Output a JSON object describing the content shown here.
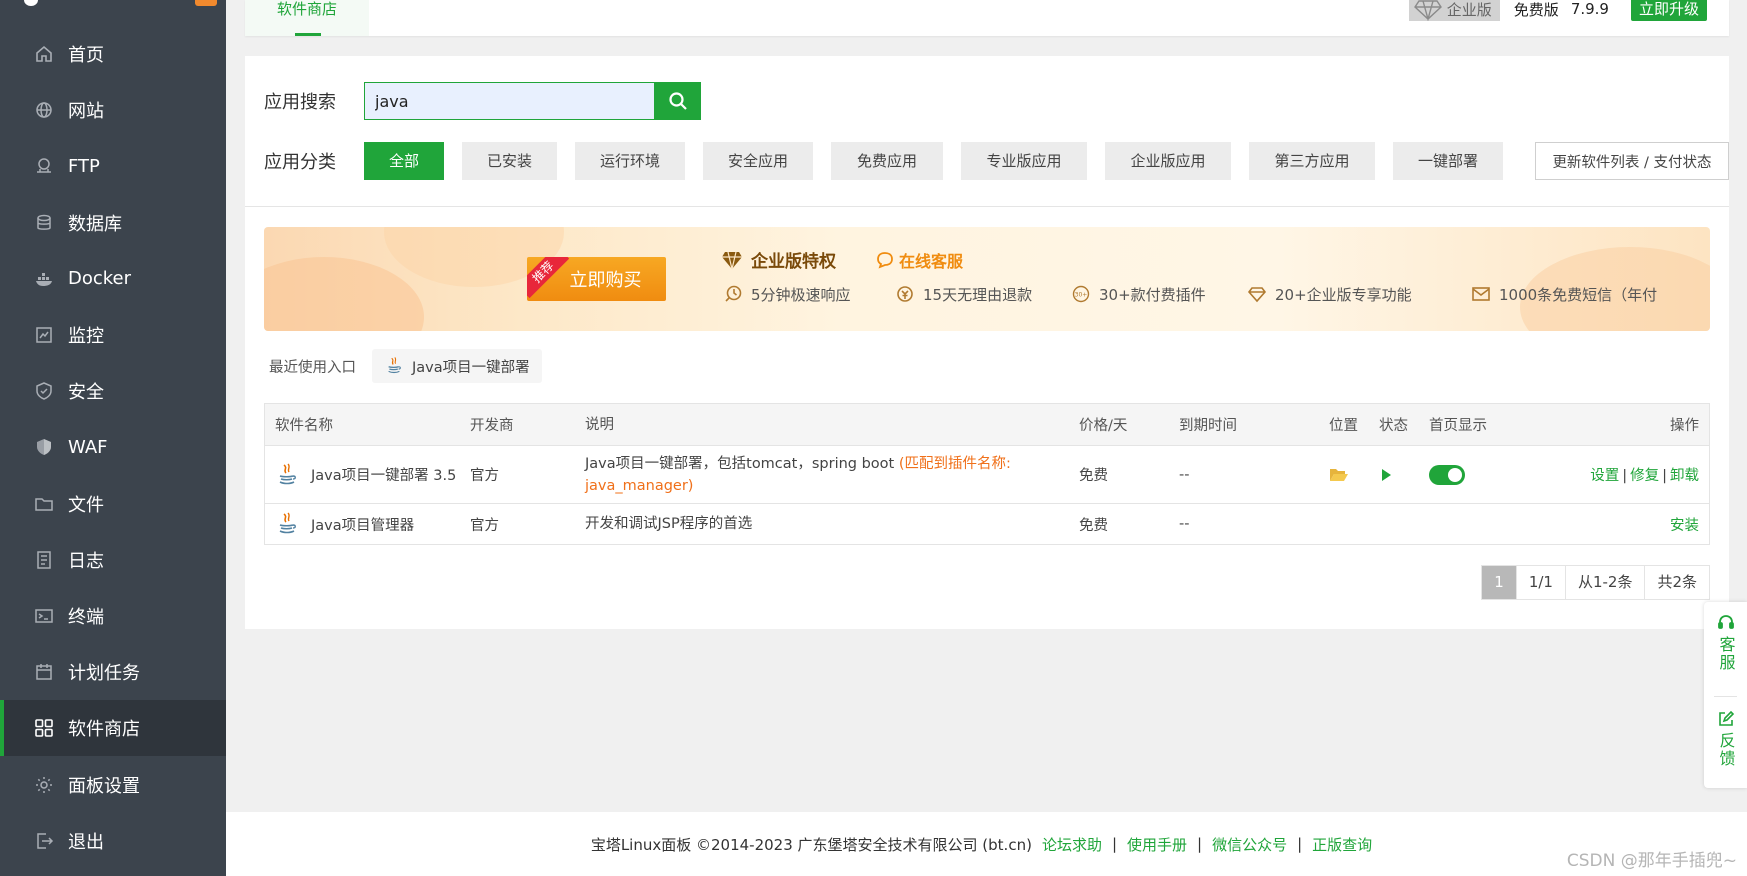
{
  "sidebar": {
    "items": [
      {
        "label": "首页",
        "icon": "home-icon"
      },
      {
        "label": "网站",
        "icon": "globe-icon"
      },
      {
        "label": "FTP",
        "icon": "ftp-icon"
      },
      {
        "label": "数据库",
        "icon": "database-icon"
      },
      {
        "label": "Docker",
        "icon": "docker-icon"
      },
      {
        "label": "监控",
        "icon": "monitor-icon"
      },
      {
        "label": "安全",
        "icon": "shield-icon"
      },
      {
        "label": "WAF",
        "icon": "waf-icon"
      },
      {
        "label": "文件",
        "icon": "folder-icon"
      },
      {
        "label": "日志",
        "icon": "log-icon"
      },
      {
        "label": "终端",
        "icon": "terminal-icon"
      },
      {
        "label": "计划任务",
        "icon": "calendar-icon"
      },
      {
        "label": "软件商店",
        "icon": "apps-icon",
        "active": true
      },
      {
        "label": "面板设置",
        "icon": "gear-icon"
      },
      {
        "label": "退出",
        "icon": "logout-icon"
      }
    ]
  },
  "header": {
    "tab_label": "软件商店",
    "edition_badge": "企业版",
    "free_label": "免费版",
    "version": "7.9.9",
    "upgrade_label": "立即升级"
  },
  "search": {
    "label": "应用搜索",
    "value": "java"
  },
  "category": {
    "label": "应用分类",
    "items": [
      "全部",
      "已安装",
      "运行环境",
      "安全应用",
      "免费应用",
      "专业版应用",
      "企业版应用",
      "第三方应用",
      "一键部署"
    ],
    "active": "全部",
    "refresh_label": "更新软件列表 / 支付状态"
  },
  "banner": {
    "ribbon": "推荐",
    "buy_label": "立即购买",
    "enterprise_title": "企业版特权",
    "customer_service": "在线客服",
    "features": [
      {
        "text": "5分钟极速响应",
        "icon": "clock-icon"
      },
      {
        "text": "15天无理由退款",
        "icon": "refund-icon"
      },
      {
        "text": "30+款付费插件",
        "icon": "plugin-icon"
      },
      {
        "text": "20+企业版专享功能",
        "icon": "diamond-icon"
      },
      {
        "text": "1000条免费短信（年付",
        "icon": "mail-icon"
      }
    ]
  },
  "recent": {
    "label": "最近使用入口",
    "items": [
      "Java项目一键部署"
    ]
  },
  "table": {
    "headers": [
      "软件名称",
      "开发商",
      "说明",
      "价格/天",
      "到期时间",
      "位置",
      "状态",
      "首页显示",
      "操作"
    ],
    "rows": [
      {
        "name": "Java项目一键部署 3.5",
        "developer": "官方",
        "desc": "Java项目一键部署，包括tomcat，spring boot",
        "match": "(匹配到插件名称: java_manager)",
        "price": "免费",
        "expire": "--",
        "ops": [
          "设置",
          "修复",
          "卸载"
        ]
      },
      {
        "name": "Java项目管理器",
        "developer": "官方",
        "desc": "开发和调试JSP程序的首选",
        "match": "",
        "price": "免费",
        "expire": "--",
        "ops": [
          "安装"
        ]
      }
    ]
  },
  "pager": {
    "current": "1",
    "pages": "1/1",
    "range": "从1-2条",
    "total": "共2条"
  },
  "float": {
    "service": "客服",
    "feedback": "反馈"
  },
  "footer": {
    "copyright": "宝塔Linux面板 ©2014-2023 广东堡塔安全技术有限公司 (bt.cn)",
    "links": [
      "论坛求助",
      "使用手册",
      "微信公众号",
      "正版查询"
    ]
  },
  "watermark": "CSDN @那年手插兜~",
  "colors": {
    "accent": "#20a53a",
    "sidebar": "#3c444d",
    "match": "#f0701a",
    "buy": "#f08c10"
  }
}
